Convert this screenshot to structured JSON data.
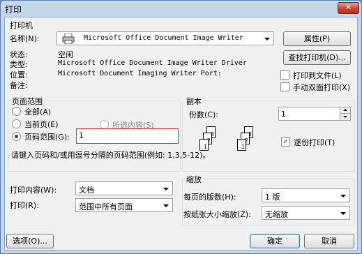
{
  "window": {
    "title": "打印",
    "close_glyph": "✕"
  },
  "printer": {
    "section": "打印机",
    "name_label": "名称(N):",
    "name_value": "Microsoft Office Document Image Writer",
    "properties_button": "属性(P)",
    "find_button": "查找打印机(D)...",
    "status_label": "状态:",
    "status_value": "空闲",
    "type_label": "类型:",
    "type_value": "Microsoft Office Document Image Writer Driver",
    "location_label": "位置:",
    "location_value": "Microsoft Document Imaging Writer Port:",
    "comment_label": "备注:",
    "print_to_file": "打印到文件(L)",
    "manual_duplex": "手动双面打印(X)"
  },
  "page_range": {
    "section": "页面范围",
    "all": "全部(A)",
    "current": "当前页(E)",
    "selection": "所选内容(S)",
    "pages": "页码范围(G):",
    "pages_value": "1",
    "hint": "请键入页码和/或用逗号分隔的页码范围(例如: 1,3,5-12)。",
    "selected": "pages"
  },
  "copies": {
    "section": "副本",
    "count_label": "份数(C):",
    "count_value": "1",
    "collate": "逐份打印(T)",
    "collate_checked": true,
    "stack1": [
      "1",
      "2",
      "3"
    ],
    "stack2": [
      "1",
      "2",
      "3"
    ]
  },
  "print_what": {
    "label": "打印内容(W):",
    "value": "文档"
  },
  "print": {
    "label": "打印(R):",
    "value": "范围中所有页面"
  },
  "zoom": {
    "section": "缩放",
    "pages_per_sheet_label": "每页的版数(H):",
    "pages_per_sheet_value": "1 版",
    "scale_label": "按纸张大小缩放(Z):",
    "scale_value": "无缩放"
  },
  "footer": {
    "options": "选项(O)...",
    "ok": "确定",
    "cancel": "取消"
  }
}
